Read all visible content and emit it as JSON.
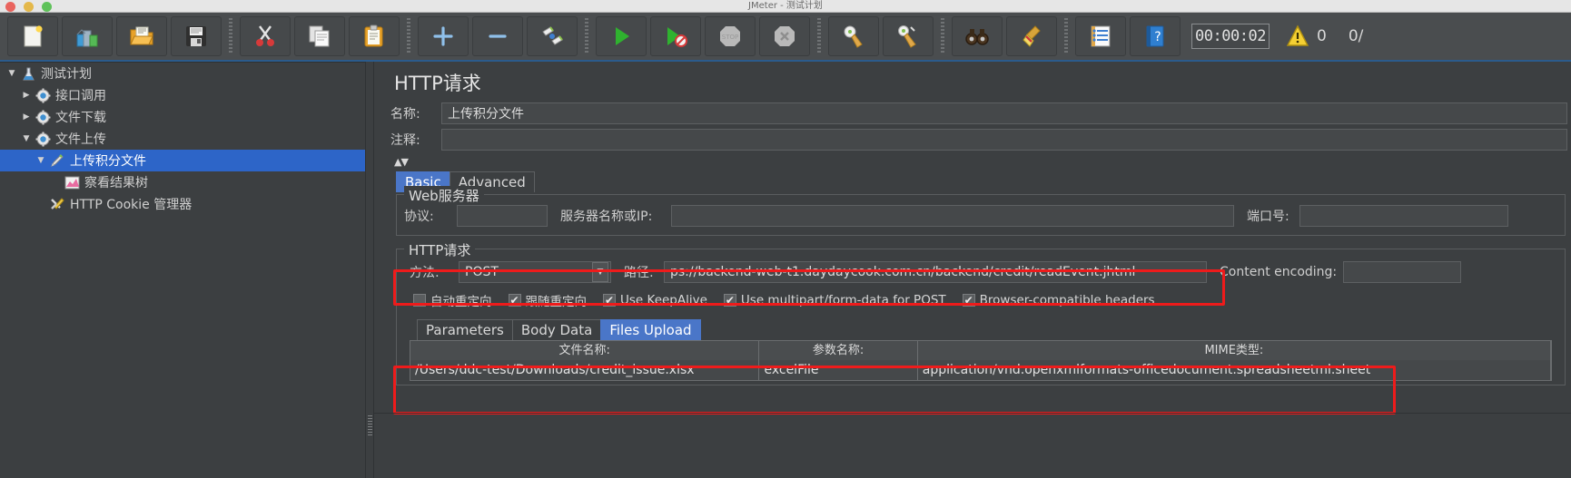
{
  "window": {
    "mac_title": "JMeter - 测试计划"
  },
  "toolbar": {
    "buttons": [
      {
        "name": "new-test-plan",
        "label": "新建",
        "icon": "new-document-icon"
      },
      {
        "name": "templates",
        "label": "模板",
        "icon": "templates-icon"
      },
      {
        "name": "open",
        "label": "打开",
        "icon": "open-folder-icon"
      },
      {
        "name": "save",
        "label": "保存",
        "icon": "save-floppy-icon"
      },
      {
        "name": "cut",
        "label": "剪切",
        "icon": "scissors-icon"
      },
      {
        "name": "copy",
        "label": "复制",
        "icon": "copy-icon"
      },
      {
        "name": "paste",
        "label": "粘贴",
        "icon": "clipboard-paste-icon"
      },
      {
        "name": "expand-all",
        "label": "展开",
        "icon": "plus-icon"
      },
      {
        "name": "collapse-all",
        "label": "折叠",
        "icon": "minus-icon"
      },
      {
        "name": "toggle",
        "label": "启用/禁用",
        "icon": "toggle-pencil-icon"
      },
      {
        "name": "start",
        "label": "启动",
        "icon": "play-green-icon"
      },
      {
        "name": "start-no-pauses",
        "label": "无暂停启动",
        "icon": "play-no-pause-icon"
      },
      {
        "name": "stop",
        "label": "停止",
        "icon": "stop-octagon-icon"
      },
      {
        "name": "shutdown",
        "label": "关闭",
        "icon": "shutdown-x-icon"
      },
      {
        "name": "clear",
        "label": "清除",
        "icon": "clear-broom-icon"
      },
      {
        "name": "clear-all",
        "label": "清除全部",
        "icon": "clear-all-broom-icon"
      },
      {
        "name": "search",
        "label": "查找",
        "icon": "binoculars-icon"
      },
      {
        "name": "reset-search",
        "label": "重置查找",
        "icon": "reset-broom-icon"
      },
      {
        "name": "function-helper",
        "label": "函数助手",
        "icon": "function-list-icon"
      },
      {
        "name": "help",
        "label": "帮助",
        "icon": "help-book-icon"
      }
    ],
    "timer_value": "00:00:02",
    "warning_icon": "warning-triangle-icon",
    "warning_count": "0",
    "thread_count": "0/"
  },
  "tree": {
    "items": [
      {
        "label": "测试计划",
        "icon": "test-plan-flask-icon",
        "twisty": "▼",
        "depth": 0,
        "selected": false
      },
      {
        "label": "接口调用",
        "icon": "thread-group-gear-icon",
        "twisty": "▶",
        "depth": 1,
        "selected": false
      },
      {
        "label": "文件下载",
        "icon": "thread-group-gear-icon",
        "twisty": "▶",
        "depth": 1,
        "selected": false
      },
      {
        "label": "文件上传",
        "icon": "thread-group-gear-icon",
        "twisty": "▼",
        "depth": 1,
        "selected": false
      },
      {
        "label": "上传积分文件",
        "icon": "http-sampler-pencil-icon",
        "twisty": "▼",
        "depth": 2,
        "selected": true
      },
      {
        "label": "察看结果树",
        "icon": "view-results-tree-icon",
        "twisty": "",
        "depth": 3,
        "selected": false
      },
      {
        "label": "HTTP Cookie 管理器",
        "icon": "cookie-manager-icon",
        "twisty": "",
        "depth": 2,
        "selected": false
      }
    ]
  },
  "main": {
    "panel_title": "HTTP请求",
    "name_label": "名称:",
    "name_value": "上传积分文件",
    "comment_label": "注释:",
    "comment_value": "",
    "tabs": [
      {
        "label": "Basic",
        "active": true
      },
      {
        "label": "Advanced",
        "active": false
      }
    ],
    "web_server": {
      "group_title": "Web服务器",
      "protocol_label": "协议:",
      "protocol_value": "",
      "server_label": "服务器名称或IP:",
      "server_value": "",
      "port_label": "端口号:",
      "port_value": ""
    },
    "http_request": {
      "group_title": "HTTP请求",
      "method_label": "方法:",
      "method_value": "POST",
      "method_dropdown_icon": "chevron-down-icon",
      "path_label": "路径:",
      "path_value": "ps://backend-web-t1.daydaycook.com.cn/backend/credit/readEvent.jhtml",
      "content_encoding_label": "Content encoding:",
      "content_encoding_value": "",
      "checkboxes": [
        {
          "label": "自动重定向",
          "checked": false
        },
        {
          "label": "跟随重定向",
          "checked": true
        },
        {
          "label": "Use KeepAlive",
          "checked": true
        },
        {
          "label": "Use multipart/form-data for POST",
          "checked": true
        },
        {
          "label": "Browser-compatible headers",
          "checked": true
        }
      ],
      "inner_tabs": [
        {
          "label": "Parameters",
          "active": false
        },
        {
          "label": "Body Data",
          "active": false
        },
        {
          "label": "Files Upload",
          "active": true
        }
      ],
      "files_table": {
        "headers": [
          "文件名称:",
          "参数名称:",
          "MIME类型:"
        ],
        "rows": [
          [
            "/Users/ddc-test/Downloads/credit_issue.xlsx",
            "excelFile",
            "application/vnd.openxmlformats-officedocument.spreadsheetml.sheet"
          ]
        ]
      }
    }
  },
  "annotations": {
    "accent_color": "#ee1b1b",
    "boxes": [
      {
        "name": "method-path-highlight"
      },
      {
        "name": "files-table-highlight"
      }
    ]
  }
}
